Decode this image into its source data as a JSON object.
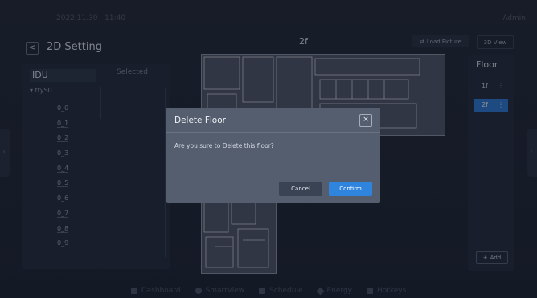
{
  "topbar": {
    "date": "2022.11.30",
    "time": "11:40",
    "user": "Admin"
  },
  "header": {
    "back": "<",
    "title": "2D Setting",
    "floor": "2f",
    "load_picture": "Load Picture",
    "view_3d": "3D View"
  },
  "left_panel": {
    "idu_label": "IDU",
    "selected_label": "Selected",
    "group": "ttyS0",
    "devices": [
      "0_0",
      "0_1",
      "0_2",
      "0_3",
      "0_4",
      "0_5",
      "0_6",
      "0_7",
      "0_8",
      "0_9"
    ]
  },
  "right_panel": {
    "floor_label": "Floor",
    "floors": [
      {
        "name": "1f",
        "active": false
      },
      {
        "name": "2f",
        "active": true
      }
    ],
    "add_label": "Add"
  },
  "bottom_nav": [
    "Dashboard",
    "SmartView",
    "Schedule",
    "Energy",
    "Hotkeys"
  ],
  "modal": {
    "title": "Delete Floor",
    "close": "×",
    "message": "Are you sure to Delete this floor?",
    "cancel": "Cancel",
    "confirm": "Confirm"
  },
  "icons": {
    "load": "swap-icon",
    "add": "plus-icon",
    "close": "close-icon",
    "back": "chevron-left-icon"
  },
  "colors": {
    "accent": "#2f84de",
    "modal_bg": "#545e6e",
    "panel_bg": "#262f3f"
  }
}
